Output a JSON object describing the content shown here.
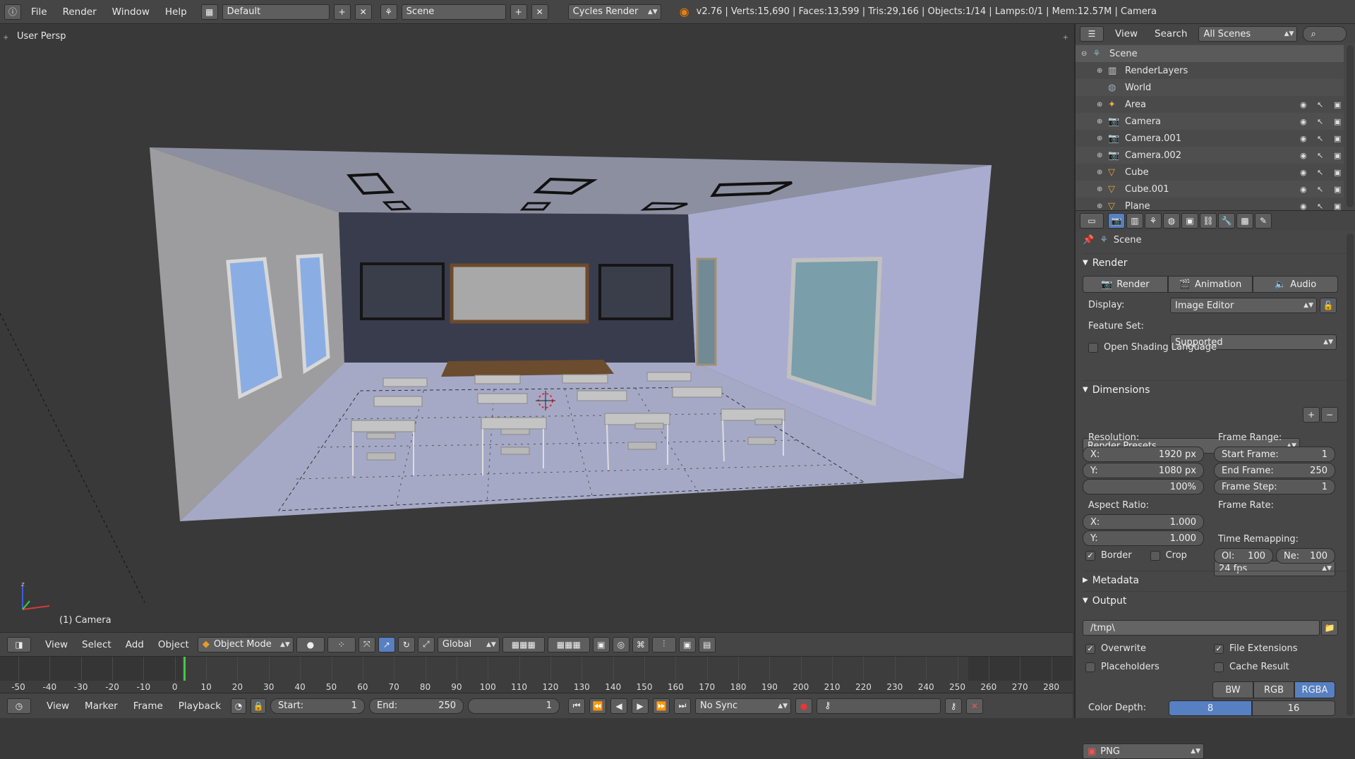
{
  "topbar": {
    "menus": [
      "File",
      "Render",
      "Window",
      "Help"
    ],
    "screen_layout": "Default",
    "scene": "Scene",
    "render_engine": "Cycles Render",
    "stats": "v2.76 | Verts:15,690 | Faces:13,599 | Tris:29,166 | Objects:1/14 | Lamps:0/1 | Mem:12.57M | Camera"
  },
  "viewport": {
    "view_label": "User Persp",
    "object_label": "(1) Camera"
  },
  "viewport_header": {
    "menus": [
      "View",
      "Select",
      "Add",
      "Object"
    ],
    "mode": "Object Mode",
    "orientation": "Global"
  },
  "timeline": {
    "ticks": [
      "-50",
      "-40",
      "-30",
      "-20",
      "-10",
      "0",
      "10",
      "20",
      "30",
      "40",
      "50",
      "60",
      "70",
      "80",
      "90",
      "100",
      "110",
      "120",
      "130",
      "140",
      "150",
      "160",
      "170",
      "180",
      "190",
      "200",
      "210",
      "220",
      "230",
      "240",
      "250",
      "260",
      "270",
      "280"
    ],
    "current_frame_marker": "0"
  },
  "timeline_header": {
    "menus": [
      "View",
      "Marker",
      "Frame",
      "Playback"
    ],
    "start_label": "Start:",
    "start_value": "1",
    "end_label": "End:",
    "end_value": "250",
    "current_frame": "1",
    "sync": "No Sync"
  },
  "outliner": {
    "menus": [
      "View",
      "Search"
    ],
    "filter": "All Scenes",
    "items": [
      {
        "name": "Scene",
        "icon": "scene-icon"
      },
      {
        "name": "RenderLayers",
        "icon": "render-layers-icon"
      },
      {
        "name": "World",
        "icon": "world-icon"
      },
      {
        "name": "Area",
        "icon": "lamp-icon"
      },
      {
        "name": "Camera",
        "icon": "camera-icon"
      },
      {
        "name": "Camera.001",
        "icon": "camera-icon"
      },
      {
        "name": "Camera.002",
        "icon": "camera-icon"
      },
      {
        "name": "Cube",
        "icon": "mesh-icon"
      },
      {
        "name": "Cube.001",
        "icon": "mesh-icon"
      },
      {
        "name": "Plane",
        "icon": "mesh-icon"
      }
    ]
  },
  "properties": {
    "context": "Scene",
    "render_section": "Render",
    "render_buttons": [
      "Render",
      "Animation",
      "Audio"
    ],
    "display_label": "Display:",
    "display_value": "Image Editor",
    "feature_set_label": "Feature Set:",
    "feature_set_value": "Supported",
    "osl_label": "Open Shading Language",
    "dimensions_section": "Dimensions",
    "render_presets": "Render Presets",
    "resolution_label": "Resolution:",
    "res_x_label": "X:",
    "res_x": "1920 px",
    "res_y_label": "Y:",
    "res_y": "1080 px",
    "res_pct": "100%",
    "frame_range_label": "Frame Range:",
    "start_frame_label": "Start Frame:",
    "start_frame": "1",
    "end_frame_label": "End Frame:",
    "end_frame": "250",
    "frame_step_label": "Frame Step:",
    "frame_step": "1",
    "aspect_label": "Aspect Ratio:",
    "aspect_x_label": "X:",
    "aspect_x": "1.000",
    "aspect_y_label": "Y:",
    "aspect_y": "1.000",
    "frame_rate_label": "Frame Rate:",
    "frame_rate": "24 fps",
    "time_remap_label": "Time Remapping:",
    "old_label": "Ol:",
    "old_value": "100",
    "new_label": "Ne:",
    "new_value": "100",
    "border_label": "Border",
    "crop_label": "Crop",
    "metadata_section": "Metadata",
    "output_section": "Output",
    "output_path": "/tmp\\",
    "overwrite_label": "Overwrite",
    "file_ext_label": "File Extensions",
    "placeholders_label": "Placeholders",
    "cache_label": "Cache Result",
    "format": "PNG",
    "color_modes": [
      "BW",
      "RGB",
      "RGBA"
    ],
    "color_depth_label": "Color Depth:",
    "color_depths": [
      "8",
      "16"
    ]
  },
  "colors": {
    "accent_blue": "#5680c2",
    "playhead_green": "#46c846"
  }
}
